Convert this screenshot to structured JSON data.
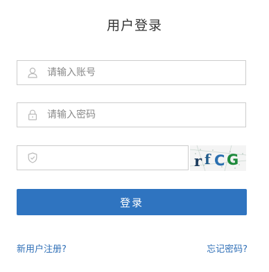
{
  "title": "用户登录",
  "account": {
    "placeholder": "请输入账号",
    "icon": "user-icon"
  },
  "password": {
    "placeholder": "请输入密码",
    "icon": "lock-icon"
  },
  "captcha": {
    "placeholder": "",
    "icon": "shield-icon",
    "image_text": "rfCG"
  },
  "login_button": "登录",
  "links": {
    "register": "新用户注册?",
    "forgot": "忘记密码?"
  },
  "colors": {
    "primary": "#2f74c0",
    "link": "#2f6fb7",
    "border": "#cccccc"
  }
}
